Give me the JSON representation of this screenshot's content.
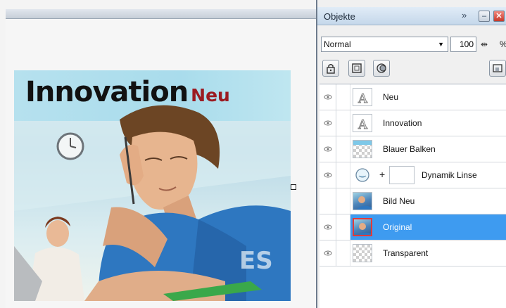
{
  "canvas": {
    "headline_main": "Innovation",
    "headline_sub": "Neu"
  },
  "panel": {
    "title": "Objekte",
    "chevron": "»",
    "minimize_icon": "minimize-icon",
    "close_icon": "close-icon"
  },
  "blend": {
    "mode": "Normal",
    "opacity": "100",
    "unit": "%"
  },
  "toolbar": {
    "icons": [
      "lock-icon",
      "mask-icon",
      "lens-icon",
      "layer-properties-icon"
    ]
  },
  "layers": [
    {
      "name": "Neu",
      "thumb": "text-icon",
      "visible": true,
      "selected": false
    },
    {
      "name": "Innovation",
      "thumb": "text-icon",
      "visible": true,
      "selected": false
    },
    {
      "name": "Blauer Balken",
      "thumb": "blue-bar-thumbnail",
      "visible": true,
      "selected": false
    },
    {
      "name": "Dynamik Linse",
      "thumb": "lens-icon",
      "visible": true,
      "selected": false
    },
    {
      "name": "Bild Neu",
      "thumb": "photo-thumbnail",
      "visible": false,
      "selected": false
    },
    {
      "name": "Original",
      "thumb": "photo-thumbnail",
      "visible": true,
      "selected": true
    },
    {
      "name": "Transparent",
      "thumb": "transparent-thumbnail",
      "visible": true,
      "selected": false
    }
  ],
  "colors": {
    "selection": "#3e9bf0",
    "headline_sub": "#9b1b22",
    "banner": "#aadcec"
  }
}
